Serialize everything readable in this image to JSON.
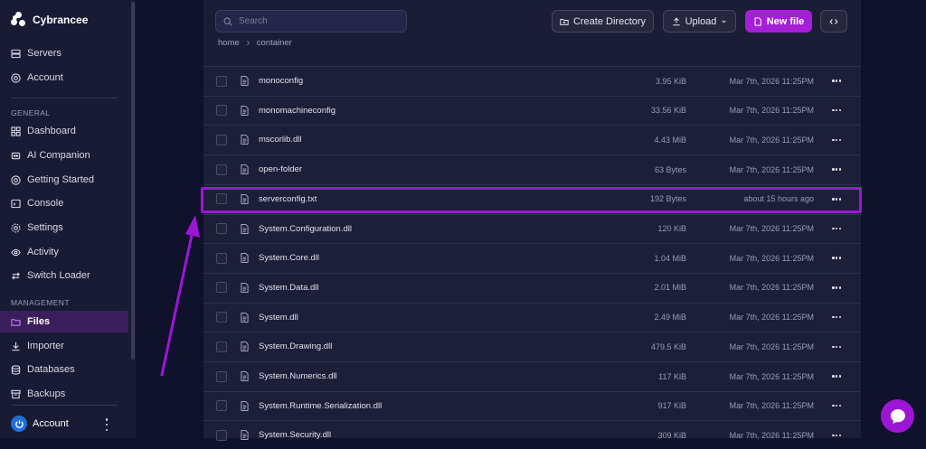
{
  "brand": {
    "name": "Cybrancee"
  },
  "sidebar": {
    "top_items": [
      {
        "label": "Servers",
        "icon": "server-icon"
      },
      {
        "label": "Account",
        "icon": "account-circle-icon"
      }
    ],
    "general_label": "GENERAL",
    "general_items": [
      {
        "label": "Dashboard",
        "icon": "dashboard-icon"
      },
      {
        "label": "AI Companion",
        "icon": "ai-icon"
      },
      {
        "label": "Getting Started",
        "icon": "lifebuoy-icon"
      },
      {
        "label": "Console",
        "icon": "terminal-icon"
      },
      {
        "label": "Settings",
        "icon": "gear-icon"
      },
      {
        "label": "Activity",
        "icon": "eye-icon"
      },
      {
        "label": "Switch Loader",
        "icon": "switch-icon"
      }
    ],
    "management_label": "MANAGEMENT",
    "management_items": [
      {
        "label": "Files",
        "icon": "folder-icon",
        "active": true
      },
      {
        "label": "Importer",
        "icon": "download-icon"
      },
      {
        "label": "Databases",
        "icon": "database-icon"
      },
      {
        "label": "Backups",
        "icon": "archive-icon"
      }
    ],
    "account_label": "Account"
  },
  "toolbar": {
    "search_placeholder": "Search",
    "create_directory": "Create Directory",
    "upload": "Upload",
    "new_file": "New file"
  },
  "breadcrumb": [
    "home",
    "container"
  ],
  "files": [
    {
      "name": "monoconfig",
      "size": "3.95 KiB",
      "modified": "Mar 7th, 2026 11:25PM"
    },
    {
      "name": "monomachineconfig",
      "size": "33.56 KiB",
      "modified": "Mar 7th, 2026 11:25PM"
    },
    {
      "name": "mscorlib.dll",
      "size": "4.43 MiB",
      "modified": "Mar 7th, 2026 11:25PM"
    },
    {
      "name": "open-folder",
      "size": "63 Bytes",
      "modified": "Mar 7th, 2026 11:25PM"
    },
    {
      "name": "serverconfig.txt",
      "size": "192 Bytes",
      "modified": "about 15 hours ago"
    },
    {
      "name": "System.Configuration.dll",
      "size": "120 KiB",
      "modified": "Mar 7th, 2026 11:25PM"
    },
    {
      "name": "System.Core.dll",
      "size": "1.04 MiB",
      "modified": "Mar 7th, 2026 11:25PM"
    },
    {
      "name": "System.Data.dll",
      "size": "2.01 MiB",
      "modified": "Mar 7th, 2026 11:25PM"
    },
    {
      "name": "System.dll",
      "size": "2.49 MiB",
      "modified": "Mar 7th, 2026 11:25PM"
    },
    {
      "name": "System.Drawing.dll",
      "size": "479.5 KiB",
      "modified": "Mar 7th, 2026 11:25PM"
    },
    {
      "name": "System.Numerics.dll",
      "size": "117 KiB",
      "modified": "Mar 7th, 2026 11:25PM"
    },
    {
      "name": "System.Runtime.Serialization.dll",
      "size": "917 KiB",
      "modified": "Mar 7th, 2026 11:25PM"
    },
    {
      "name": "System.Security.dll",
      "size": "309 KiB",
      "modified": "Mar 7th, 2026 11:25PM"
    }
  ],
  "colors": {
    "accent": "#a51fd6",
    "highlight": "#9b16d8",
    "sidebar_bg": "#191a33",
    "main_bg": "#1d1e38"
  }
}
